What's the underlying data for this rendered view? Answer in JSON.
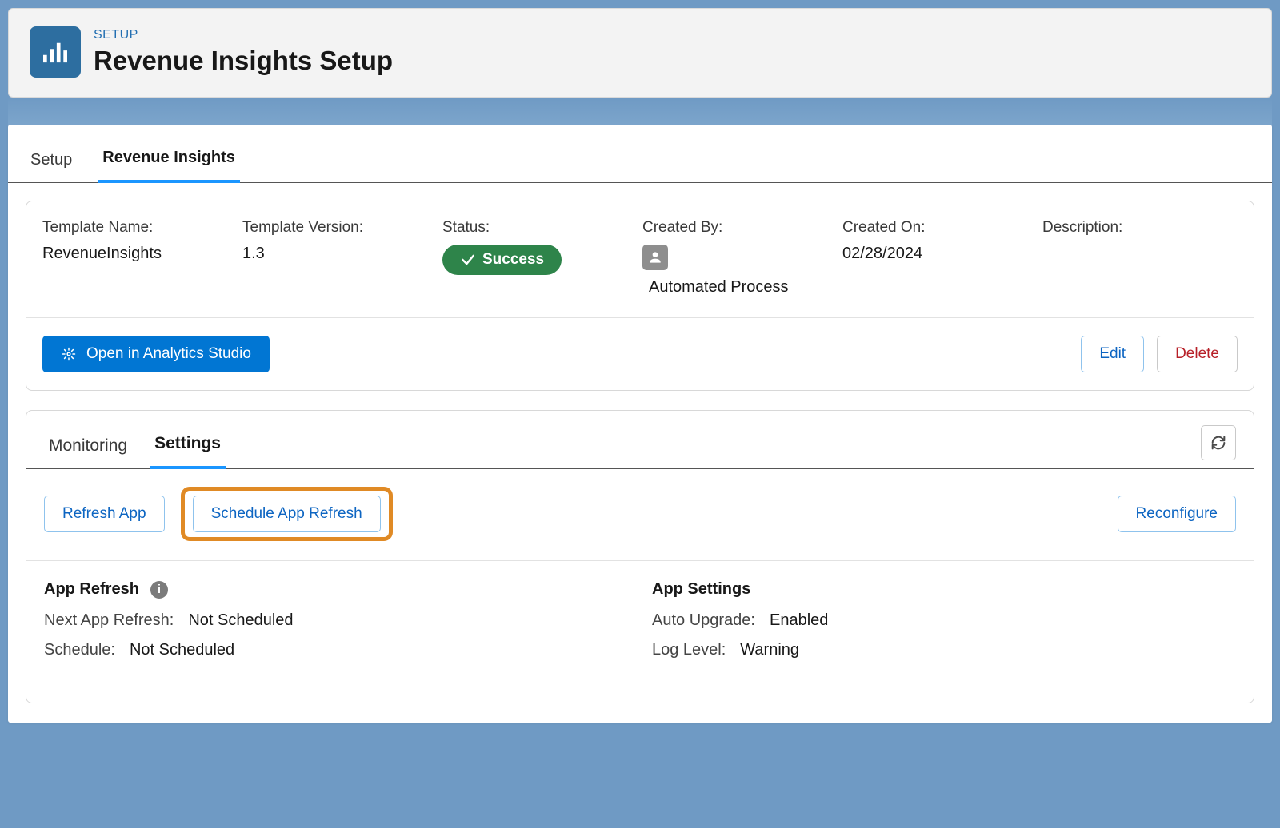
{
  "header": {
    "breadcrumb": "SETUP",
    "title": "Revenue Insights Setup"
  },
  "tabs_top": [
    {
      "label": "Setup",
      "active": false
    },
    {
      "label": "Revenue Insights",
      "active": true
    }
  ],
  "info": {
    "template_name_label": "Template Name:",
    "template_name_value": "RevenueInsights",
    "template_version_label": "Template Version:",
    "template_version_value": "1.3",
    "status_label": "Status:",
    "status_value": "Success",
    "created_by_label": "Created By:",
    "created_by_value": "Automated Process",
    "created_on_label": "Created On:",
    "created_on_value": "02/28/2024",
    "description_label": "Description:"
  },
  "buttons": {
    "open_analytics": "Open in Analytics Studio",
    "edit": "Edit",
    "delete": "Delete"
  },
  "tabs_settings": [
    {
      "label": "Monitoring",
      "active": false
    },
    {
      "label": "Settings",
      "active": true
    }
  ],
  "setting_actions": {
    "refresh_app": "Refresh App",
    "schedule_app_refresh": "Schedule App Refresh",
    "reconfigure": "Reconfigure"
  },
  "app_refresh": {
    "title": "App Refresh",
    "next_label": "Next App Refresh:",
    "next_value": "Not Scheduled",
    "schedule_label": "Schedule:",
    "schedule_value": "Not Scheduled"
  },
  "app_settings": {
    "title": "App Settings",
    "auto_upgrade_label": "Auto Upgrade:",
    "auto_upgrade_value": "Enabled",
    "log_level_label": "Log Level:",
    "log_level_value": "Warning"
  }
}
